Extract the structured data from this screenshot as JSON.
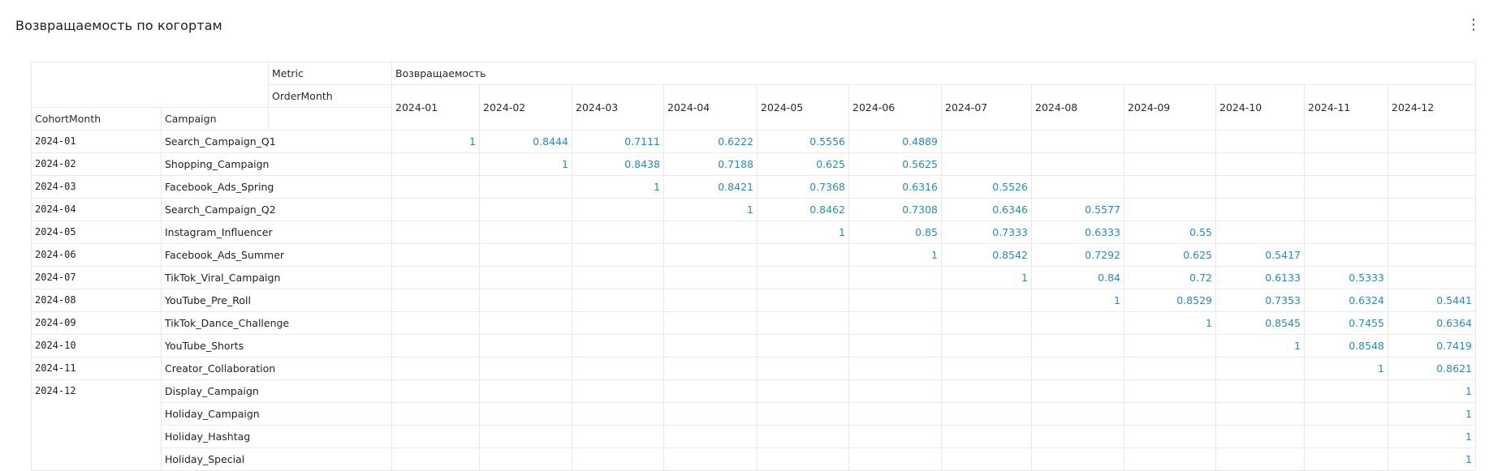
{
  "panel": {
    "title": "Возвращаемость по когортам",
    "menu_icon": "more-vertical-icon"
  },
  "pivot": {
    "labels": {
      "metric": "Metric",
      "order_month": "OrderMonth",
      "cohort_month": "CohortMonth",
      "campaign": "Campaign",
      "metric_name": "Возвращаемость"
    },
    "months": [
      "2024-01",
      "2024-02",
      "2024-03",
      "2024-04",
      "2024-05",
      "2024-06",
      "2024-07",
      "2024-08",
      "2024-09",
      "2024-10",
      "2024-11",
      "2024-12"
    ],
    "rows": [
      {
        "cohort": "2024-01",
        "campaign": "Search_Campaign_Q1",
        "values": [
          "1",
          "0.8444",
          "0.7111",
          "0.6222",
          "0.5556",
          "0.4889",
          "",
          "",
          "",
          "",
          "",
          ""
        ]
      },
      {
        "cohort": "2024-02",
        "campaign": "Shopping_Campaign",
        "values": [
          "",
          "1",
          "0.8438",
          "0.7188",
          "0.625",
          "0.5625",
          "",
          "",
          "",
          "",
          "",
          ""
        ]
      },
      {
        "cohort": "2024-03",
        "campaign": "Facebook_Ads_Spring",
        "values": [
          "",
          "",
          "1",
          "0.8421",
          "0.7368",
          "0.6316",
          "0.5526",
          "",
          "",
          "",
          "",
          ""
        ]
      },
      {
        "cohort": "2024-04",
        "campaign": "Search_Campaign_Q2",
        "values": [
          "",
          "",
          "",
          "1",
          "0.8462",
          "0.7308",
          "0.6346",
          "0.5577",
          "",
          "",
          "",
          ""
        ]
      },
      {
        "cohort": "2024-05",
        "campaign": "Instagram_Influencer",
        "values": [
          "",
          "",
          "",
          "",
          "1",
          "0.85",
          "0.7333",
          "0.6333",
          "0.55",
          "",
          "",
          ""
        ]
      },
      {
        "cohort": "2024-06",
        "campaign": "Facebook_Ads_Summer",
        "values": [
          "",
          "",
          "",
          "",
          "",
          "1",
          "0.8542",
          "0.7292",
          "0.625",
          "0.5417",
          "",
          ""
        ]
      },
      {
        "cohort": "2024-07",
        "campaign": "TikTok_Viral_Campaign",
        "values": [
          "",
          "",
          "",
          "",
          "",
          "",
          "1",
          "0.84",
          "0.72",
          "0.6133",
          "0.5333",
          ""
        ]
      },
      {
        "cohort": "2024-08",
        "campaign": "YouTube_Pre_Roll",
        "values": [
          "",
          "",
          "",
          "",
          "",
          "",
          "",
          "1",
          "0.8529",
          "0.7353",
          "0.6324",
          "0.5441"
        ]
      },
      {
        "cohort": "2024-09",
        "campaign": "TikTok_Dance_Challenge",
        "values": [
          "",
          "",
          "",
          "",
          "",
          "",
          "",
          "",
          "1",
          "0.8545",
          "0.7455",
          "0.6364"
        ]
      },
      {
        "cohort": "2024-10",
        "campaign": "YouTube_Shorts",
        "values": [
          "",
          "",
          "",
          "",
          "",
          "",
          "",
          "",
          "",
          "1",
          "0.8548",
          "0.7419"
        ]
      },
      {
        "cohort": "2024-11",
        "campaign": "Creator_Collaboration",
        "values": [
          "",
          "",
          "",
          "",
          "",
          "",
          "",
          "",
          "",
          "",
          "1",
          "0.8621"
        ]
      },
      {
        "cohort": "2024-12",
        "campaign": "Display_Campaign",
        "values": [
          "",
          "",
          "",
          "",
          "",
          "",
          "",
          "",
          "",
          "",
          "",
          "1"
        ]
      },
      {
        "cohort": "",
        "campaign": "Holiday_Campaign",
        "values": [
          "",
          "",
          "",
          "",
          "",
          "",
          "",
          "",
          "",
          "",
          "",
          "1"
        ]
      },
      {
        "cohort": "",
        "campaign": "Holiday_Hashtag",
        "values": [
          "",
          "",
          "",
          "",
          "",
          "",
          "",
          "",
          "",
          "",
          "",
          "1"
        ]
      },
      {
        "cohort": "",
        "campaign": "Holiday_Special",
        "values": [
          "",
          "",
          "",
          "",
          "",
          "",
          "",
          "",
          "",
          "",
          "",
          "1"
        ]
      }
    ]
  },
  "colors": {
    "value_text": "#2a8ab7",
    "grid_line": "#e6e8ea"
  }
}
